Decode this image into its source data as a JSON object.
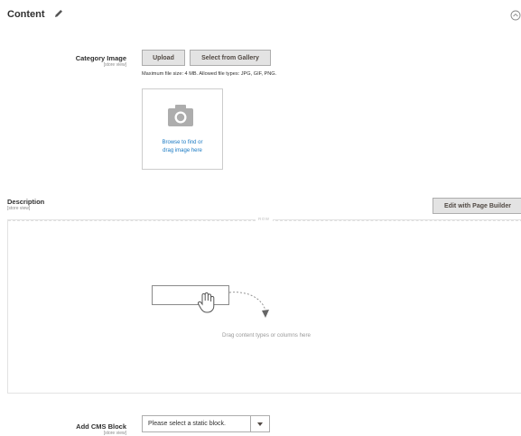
{
  "section": {
    "title": "Content"
  },
  "category_image": {
    "label": "Category Image",
    "scope": "[store view]",
    "upload_button": "Upload",
    "gallery_button": "Select from Gallery",
    "file_note": "Maximum file size: 4 MB. Allowed file types: JPG, GIF, PNG.",
    "browse_line1": "Browse to find or",
    "browse_line2": "drag image here"
  },
  "description": {
    "label": "Description",
    "scope": "[store view]",
    "page_builder_button": "Edit with Page Builder",
    "row_label": "ROW",
    "drag_hint": "Drag content types or columns here"
  },
  "cms_block": {
    "label": "Add CMS Block",
    "scope": "[store view]",
    "selected": "Please select a static block."
  },
  "icons": {
    "pencil": "pencil-icon",
    "collapse": "chevron-up-circle-icon",
    "camera": "camera-icon",
    "hand": "hand-icon",
    "arrow": "curved-arrow-icon",
    "dropdown": "caret-down-icon"
  },
  "colors": {
    "link": "#1979c3",
    "button_bg": "#e3e3e3",
    "button_border": "#adadad"
  }
}
